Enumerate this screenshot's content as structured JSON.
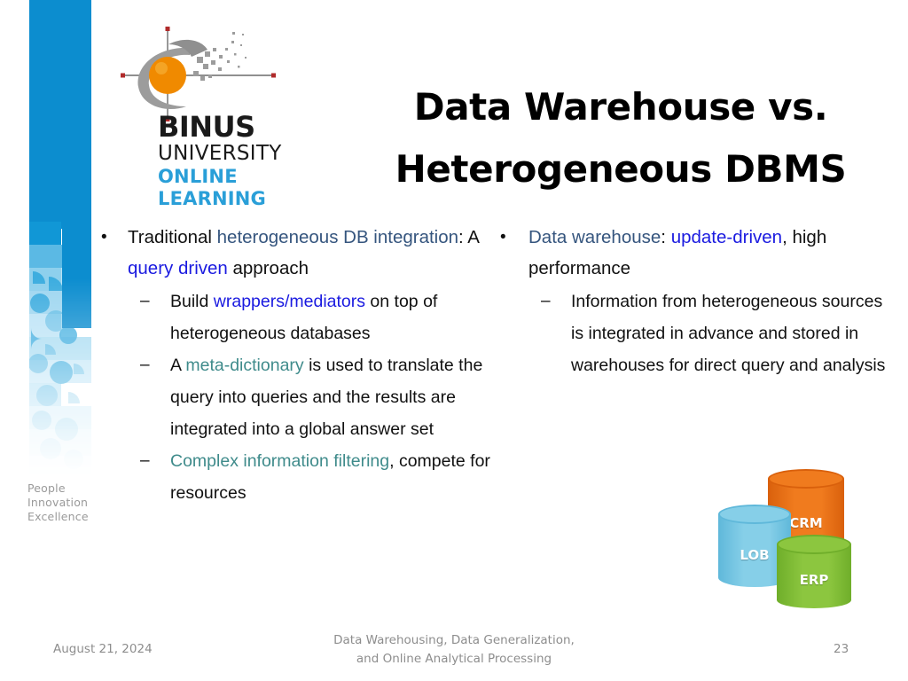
{
  "slide": {
    "title_line1": "Data Warehouse vs.",
    "title_line2": "Heterogeneous DBMS",
    "background": "#ffffff"
  },
  "logo": {
    "name": "binus-university-online-learning-logo",
    "binus": "BINUS",
    "university": "UNIVERSITY",
    "online": "ONLINE",
    "learning": "LEARNING",
    "accent_color": "#2a9fd8",
    "orb_color": "#f08a00",
    "swoosh_color": "#9a9a9a"
  },
  "sidebar": {
    "bar_color": "#0c8dcf",
    "tagline_line1": "People",
    "tagline_line2": "Innovation",
    "tagline_line3": "Excellence"
  },
  "content": {
    "left_column": {
      "level1_marker": "•",
      "level2_marker": "–",
      "bullets": [
        {
          "level": 1,
          "runs": [
            {
              "text": "Traditional ",
              "style": "plain"
            },
            {
              "text": "heterogeneous DB integration",
              "style": "slate"
            },
            {
              "text": ": A ",
              "style": "plain"
            },
            {
              "text": "query driven",
              "style": "blue"
            },
            {
              "text": " approach",
              "style": "plain"
            }
          ]
        },
        {
          "level": 2,
          "runs": [
            {
              "text": "Build ",
              "style": "plain"
            },
            {
              "text": "wrappers/mediators",
              "style": "blue"
            },
            {
              "text": " on top of heterogeneous databases",
              "style": "plain"
            }
          ]
        },
        {
          "level": 2,
          "runs": [
            {
              "text": "A ",
              "style": "plain"
            },
            {
              "text": "meta-dictionary",
              "style": "teal"
            },
            {
              "text": " is used to translate the query into queries and the results are integrated into a global answer set",
              "style": "plain"
            }
          ]
        },
        {
          "level": 2,
          "runs": [
            {
              "text": "Complex information filtering",
              "style": "teal"
            },
            {
              "text": ", compete for resources",
              "style": "plain"
            }
          ]
        }
      ]
    },
    "right_column": {
      "level1_marker": "•",
      "level2_marker": "–",
      "bullets": [
        {
          "level": 1,
          "runs": [
            {
              "text": "Data warehouse",
              "style": "slate"
            },
            {
              "text": ": ",
              "style": "plain"
            },
            {
              "text": "update-driven",
              "style": "blue"
            },
            {
              "text": ", high performance",
              "style": "plain"
            }
          ]
        },
        {
          "level": 2,
          "runs": [
            {
              "text": "Information from heterogeneous sources is integrated in advance and stored in warehouses for direct query and analysis",
              "style": "plain"
            }
          ]
        }
      ]
    }
  },
  "artwork": {
    "name": "database-cylinders",
    "cylinders": [
      {
        "label": "CRM",
        "color": "#f07b1e",
        "color_dark": "#d9600c"
      },
      {
        "label": "LOB",
        "color": "#86cfe8",
        "color_dark": "#5fb8da"
      },
      {
        "label": "ERP",
        "color": "#8cc63f",
        "color_dark": "#6fae2a"
      }
    ]
  },
  "footer": {
    "date": "August 21, 2024",
    "center_line1": "Data Warehousing, Data Generalization,",
    "center_line2": "and Online Analytical Processing",
    "page_number": "23"
  },
  "colors": {
    "slate_highlight": "#35557e",
    "blue_highlight": "#1a1ae0",
    "teal_highlight": "#3f8b8b",
    "body_text": "#111111",
    "footer_text": "#8d8d8d"
  }
}
